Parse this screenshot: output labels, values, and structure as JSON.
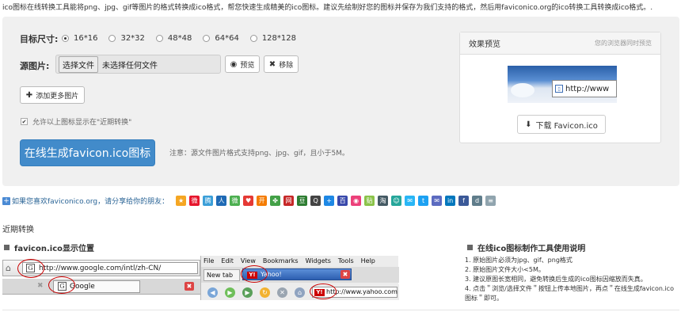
{
  "intro": "ico图标在线转换工具能将png、jpg、gif等图片的格式转换成ico格式，帮您快速生成精美的ico图标。建议先绘制好您的图标并保存为我们支持的格式，然后用faviconico.org的ico转换工具转换成ico格式。.",
  "form": {
    "size_label": "目标尺寸:",
    "sizes": [
      {
        "label": "16*16",
        "checked": true
      },
      {
        "label": "32*32",
        "checked": false
      },
      {
        "label": "48*48",
        "checked": false
      },
      {
        "label": "64*64",
        "checked": false
      },
      {
        "label": "128*128",
        "checked": false
      }
    ],
    "source_label": "源图片:",
    "file_button": "选择文件",
    "file_status": "未选择任何文件",
    "preview_button": "预览",
    "remove_button": "移除",
    "add_more_button": "添加更多图片",
    "allow_recent_label": "允许以上图标显示在\"近期转换\"",
    "allow_recent_checked": true,
    "generate_button": "在线生成favicon.ico图标",
    "note": "注意：源文件图片格式支持png、jpg、gif，且小于5M。"
  },
  "preview": {
    "title": "效果预览",
    "hint": "您的浏览器同时预览",
    "url_text": "http://www",
    "download_button": "下载 Favicon.ico"
  },
  "share": {
    "text": "如果您喜欢faviconico.org，请分享给你的朋友：",
    "icons": [
      {
        "name": "qzone-share-icon",
        "color": "#f5a623",
        "glyph": "★"
      },
      {
        "name": "sina-weibo-share-icon",
        "color": "#e6162d",
        "glyph": "微"
      },
      {
        "name": "tencent-weibo-share-icon",
        "color": "#3b9fd8",
        "glyph": "腾"
      },
      {
        "name": "renren-share-icon",
        "color": "#1f6ab5",
        "glyph": "人"
      },
      {
        "name": "wechat-share-icon",
        "color": "#4caf50",
        "glyph": "微"
      },
      {
        "name": "heart-share-icon",
        "color": "#e53935",
        "glyph": "♥"
      },
      {
        "name": "kaixin-share-icon",
        "color": "#f57c00",
        "glyph": "开"
      },
      {
        "name": "clover-share-icon",
        "color": "#43a047",
        "glyph": "✤"
      },
      {
        "name": "netease-share-icon",
        "color": "#c62828",
        "glyph": "网"
      },
      {
        "name": "douban-share-icon",
        "color": "#2e7d32",
        "glyph": "豆"
      },
      {
        "name": "qq-share-icon",
        "color": "#444444",
        "glyph": "Q"
      },
      {
        "name": "plus-share-icon",
        "color": "#1e88e5",
        "glyph": "+"
      },
      {
        "name": "baidu-share-icon",
        "color": "#3949ab",
        "glyph": "百"
      },
      {
        "name": "bookmark-share-icon",
        "color": "#ec407a",
        "glyph": "◉"
      },
      {
        "name": "tieba-share-icon",
        "color": "#8bc34a",
        "glyph": "贴"
      },
      {
        "name": "taobao-share-icon",
        "color": "#455a64",
        "glyph": "淘"
      },
      {
        "name": "people-share-icon",
        "color": "#26a69a",
        "glyph": "☺"
      },
      {
        "name": "message-share-icon",
        "color": "#29b6f6",
        "glyph": "✉"
      },
      {
        "name": "twitter-share-icon",
        "color": "#1da1f2",
        "glyph": "t"
      },
      {
        "name": "mail-share-icon",
        "color": "#5c6bc0",
        "glyph": "✉"
      },
      {
        "name": "linkedin-share-icon",
        "color": "#0277bd",
        "glyph": "in"
      },
      {
        "name": "facebook-share-icon",
        "color": "#3b5998",
        "glyph": "f"
      },
      {
        "name": "delicious-share-icon",
        "color": "#607d8b",
        "glyph": "d"
      },
      {
        "name": "more-share-icon",
        "color": "#90a4ae",
        "glyph": "≡"
      }
    ]
  },
  "recent_title": "近期转换",
  "location": {
    "title": "favicon.ico显示位置",
    "ie_url": "http://www.google.com/intl/zh-CN/",
    "ie_tab": "Google",
    "ff_menu": [
      "File",
      "Edit",
      "View",
      "Bookmarks",
      "Widgets",
      "Tools",
      "Help"
    ],
    "ff_newtab": "New tab",
    "ff_tab": "Yahoo!",
    "ff_url": "http://www.yahoo.com"
  },
  "instructions": {
    "title": "在线ico图标制作工具使用说明",
    "items": [
      "1. 原始图片必须为jpg、gif、png格式",
      "2. 原始图片文件大小<5M。",
      "3. 建议原图长宽相同，避免转换后生成的ico图标因缩放而失真。",
      "4. 点击＂浏览/选择文件＂按钮上传本地图片，再点＂在线生成favicon.ico图标＂即可。"
    ]
  }
}
